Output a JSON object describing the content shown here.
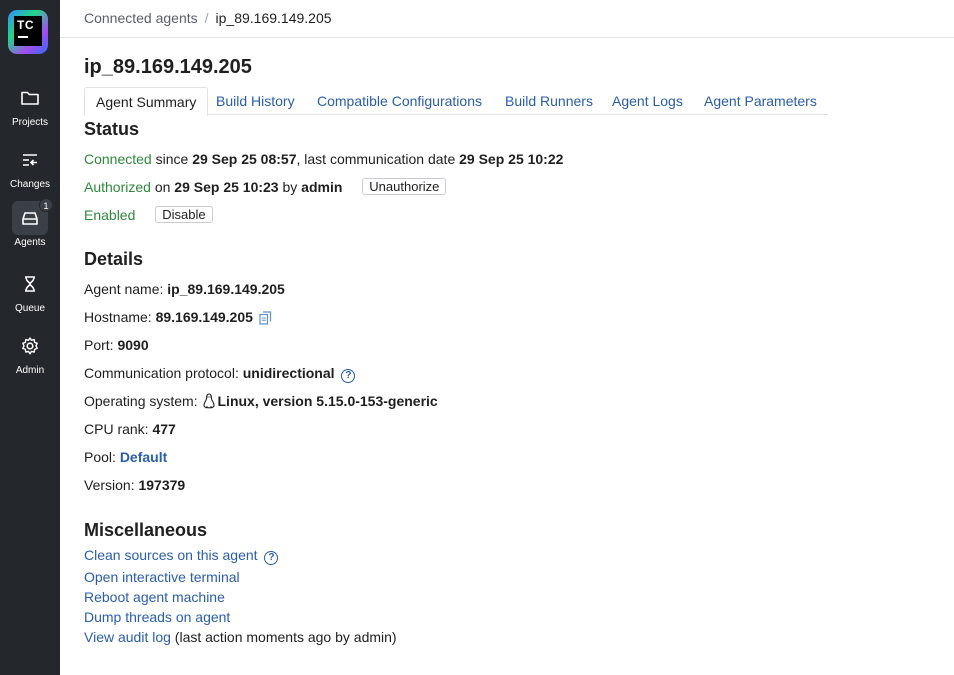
{
  "sidebar": {
    "logo_text": "TC",
    "items": [
      {
        "label": "Projects",
        "icon": "folder-icon"
      },
      {
        "label": "Changes",
        "icon": "changes-icon"
      },
      {
        "label": "Agents",
        "icon": "agents-icon",
        "badge": "1",
        "active": true
      },
      {
        "label": "Queue",
        "icon": "hourglass-icon"
      },
      {
        "label": "Admin",
        "icon": "gear-icon"
      }
    ]
  },
  "breadcrumb": {
    "parent": "Connected agents",
    "separator": "/",
    "current": "ip_89.169.149.205"
  },
  "page_title": "ip_89.169.149.205",
  "tabs": [
    "Agent Summary",
    "Build History",
    "Compatible Configurations",
    "Build Runners",
    "Agent Logs",
    "Agent Parameters"
  ],
  "status": {
    "heading": "Status",
    "connected": "Connected",
    "since_label": " since ",
    "since_date": "29 Sep 25 08:57",
    "last_comm_label": ", last communication date ",
    "last_comm_date": "29 Sep 25 10:22",
    "authorized": "Authorized",
    "on_label": " on ",
    "auth_date": "29 Sep 25 10:23",
    "by_label": " by ",
    "auth_user": "admin",
    "unauthorize_btn": "Unauthorize",
    "enabled": "Enabled",
    "disable_btn": "Disable"
  },
  "details": {
    "heading": "Details",
    "agent_name_label": "Agent name: ",
    "agent_name": "ip_89.169.149.205",
    "hostname_label": "Hostname: ",
    "hostname": "89.169.149.205",
    "port_label": "Port: ",
    "port": "9090",
    "protocol_label": "Communication protocol: ",
    "protocol": "unidirectional",
    "os_label": "Operating system: ",
    "os": "Linux, version 5.15.0-153-generic",
    "cpu_label": "CPU rank: ",
    "cpu": "477",
    "pool_label": "Pool: ",
    "pool": "Default",
    "version_label": "Version: ",
    "version": "197379"
  },
  "misc": {
    "heading": "Miscellaneous",
    "clean_sources": "Clean sources on this agent",
    "open_terminal": "Open interactive terminal",
    "reboot": "Reboot agent machine",
    "dump_threads": "Dump threads on agent",
    "audit_log": "View audit log",
    "audit_note": " (last action moments ago by admin)"
  },
  "colors": {
    "sidebar_bg": "#24272c",
    "link": "#2a5eab",
    "status_green": "#2e8a3b"
  }
}
